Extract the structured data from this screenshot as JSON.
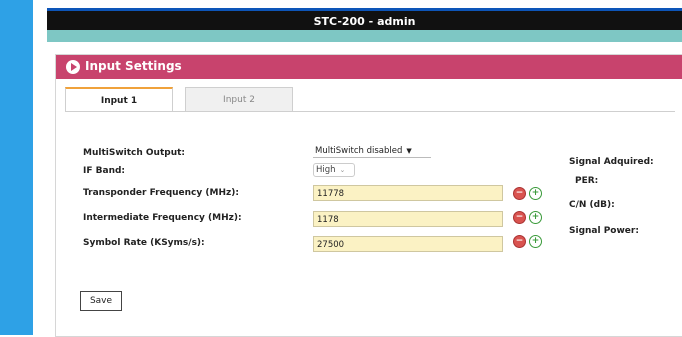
{
  "window": {
    "title": "STC-200 - admin"
  },
  "panel": {
    "title": "Input Settings"
  },
  "tabs": [
    {
      "label": "Input 1",
      "active": true
    },
    {
      "label": "Input 2",
      "active": false
    }
  ],
  "form": {
    "multiswitch": {
      "label": "MultiSwitch Output:",
      "value": "MultiSwitch disabled"
    },
    "ifband": {
      "label": "IF Band:",
      "value": "High"
    },
    "transponder": {
      "label": "Transponder Frequency (MHz):",
      "value": "11778"
    },
    "intermediate": {
      "label": "Intermediate Frequency (MHz):",
      "value": "1178"
    },
    "symbol": {
      "label": "Symbol Rate (KSyms/s):",
      "value": "27500"
    }
  },
  "status": {
    "signal_acquired": "Signal Adquired:",
    "per": "PER:",
    "cn": "C/N (dB):",
    "signal_power": "Signal Power:"
  },
  "buttons": {
    "save": "Save",
    "minus": "−",
    "plus": "+"
  },
  "colors": {
    "accent_left": "#2ea1e6",
    "panel_header": "#c8436d",
    "teal_bar": "#7ec7c4",
    "input_bg": "#fbf2c4"
  }
}
